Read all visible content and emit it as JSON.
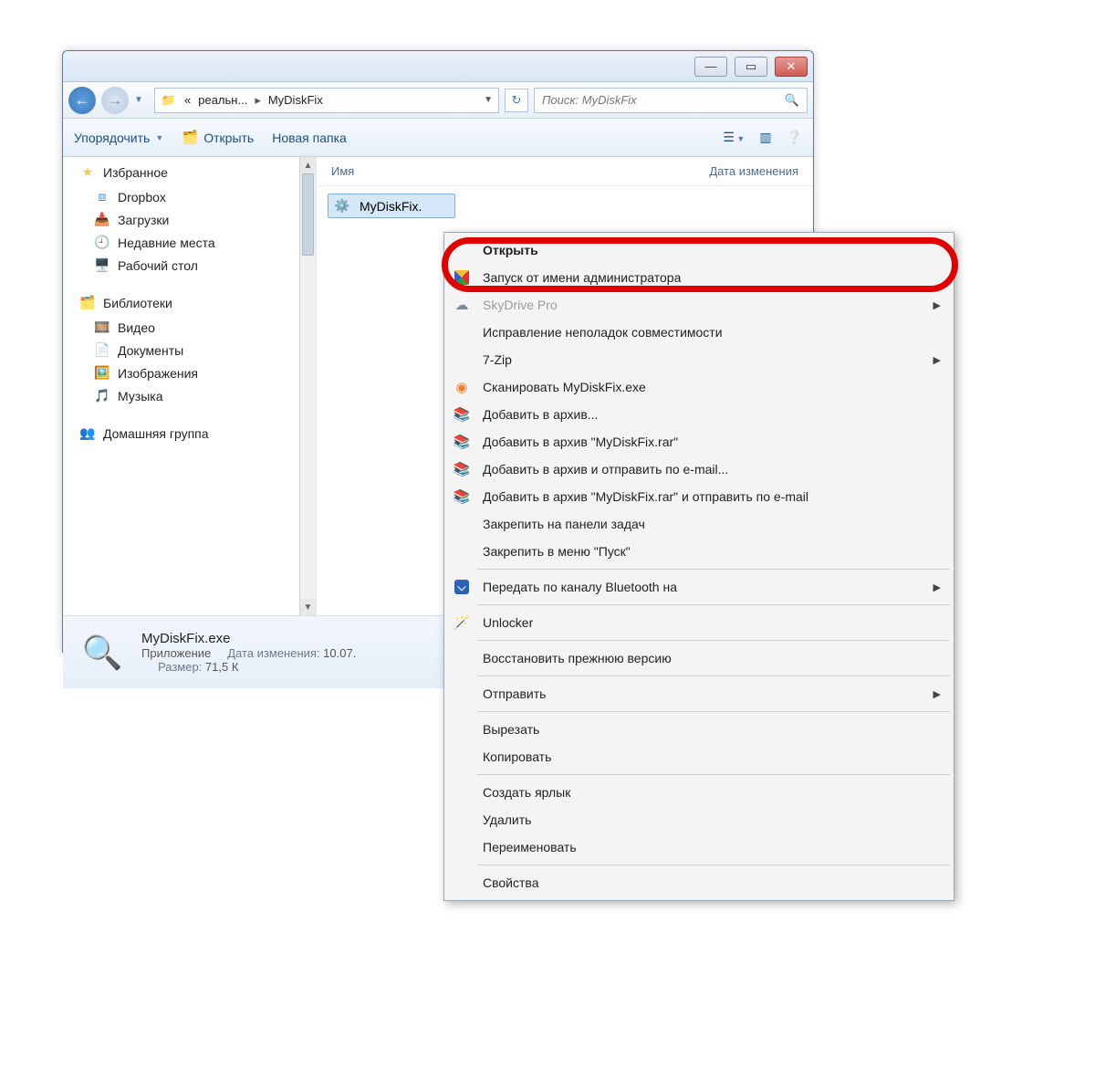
{
  "titlebar": {
    "min": "—",
    "max": "▭",
    "close": "✕"
  },
  "breadcrumb": {
    "chevL": "«",
    "part1": "реальн...",
    "sep": "▸",
    "part2": "MyDiskFix"
  },
  "search": {
    "placeholder": "Поиск: MyDiskFix"
  },
  "toolbar": {
    "organize": "Упорядочить",
    "open": "Открыть",
    "newfolder": "Новая папка"
  },
  "columns": {
    "name": "Имя",
    "date": "Дата изменения"
  },
  "nav": {
    "favorites": "Избранное",
    "dropbox": "Dropbox",
    "downloads": "Загрузки",
    "recent": "Недавние места",
    "desktop": "Рабочий стол",
    "libraries": "Библиотеки",
    "video": "Видео",
    "documents": "Документы",
    "images": "Изображения",
    "music": "Музыка",
    "homegroup": "Домашняя группа"
  },
  "file": {
    "name_short": "MyDiskFix."
  },
  "details": {
    "filename": "MyDiskFix.exe",
    "app": "Приложение",
    "date_k": "Дата изменения:",
    "date_v": "10.07.",
    "size_k": "Размер:",
    "size_v": "71,5 К"
  },
  "cm": {
    "open": "Открыть",
    "runas": "Запуск от имени администратора",
    "skydrive": "SkyDrive Pro",
    "compat": "Исправление неполадок совместимости",
    "sevenzip": "7-Zip",
    "scan": "Сканировать MyDiskFix.exe",
    "addarc": "Добавить в архив...",
    "addrar": "Добавить в архив \"MyDiskFix.rar\"",
    "addemail": "Добавить в архив и отправить по e-mail...",
    "addraremail": "Добавить в архив \"MyDiskFix.rar\" и отправить по e-mail",
    "pintask": "Закрепить на панели задач",
    "pinstart": "Закрепить в меню \"Пуск\"",
    "bluetooth": "Передать по каналу Bluetooth на",
    "unlocker": "Unlocker",
    "restore": "Восстановить прежнюю версию",
    "sendto": "Отправить",
    "cut": "Вырезать",
    "copy": "Копировать",
    "shortcut": "Создать ярлык",
    "delete": "Удалить",
    "rename": "Переименовать",
    "properties": "Свойства"
  }
}
